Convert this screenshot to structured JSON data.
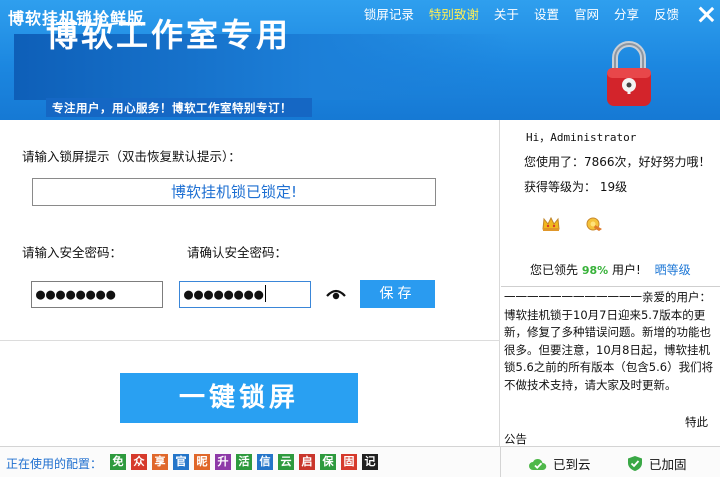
{
  "app": {
    "title": "博软挂机锁抢鲜版"
  },
  "topnav": [
    {
      "label": "锁屏记录",
      "highlight": false
    },
    {
      "label": "特别致谢",
      "highlight": true
    },
    {
      "label": "关于",
      "highlight": false
    },
    {
      "label": "设置",
      "highlight": false
    },
    {
      "label": "官网",
      "highlight": false
    },
    {
      "label": "分享",
      "highlight": false
    },
    {
      "label": "反馈",
      "highlight": false
    }
  ],
  "banner": {
    "title": "博软工作室专用",
    "slogan": "专注用户，用心服务！博软工作室特别专订！"
  },
  "form": {
    "hint_label": "请输入锁屏提示（双击恢复默认提示）：",
    "hint_value": "博软挂机锁已锁定!",
    "password_label": "请输入安全密码：",
    "confirm_label": "请确认安全密码：",
    "password_mask": "●●●●●●●●",
    "confirm_mask": "●●●●●●●●",
    "save_label": "保存",
    "lock_label": "一键锁屏"
  },
  "user": {
    "greeting": "Hi，Administrator",
    "usage": "您使用了：7866次，好好努力哦！",
    "level": "获得等级为： 19级",
    "rank_prefix": "您已领先",
    "rank_percent": "98%",
    "rank_suffix": "用户!",
    "show_level": "晒等级"
  },
  "notice": {
    "text": "一一一一一一一一一一一一亲爱的用户：博软挂机锁于10月7日迎来5.7版本的更新，修复了多种错误问题。新增的功能也很多。但要注意，10月8日起，博软挂机锁5.6之前的所有版本（包含5.6）我们将不做技术支持，请大家及时更新。",
    "special": "特此",
    "footer": "公告"
  },
  "bottom": {
    "config_label": "正在使用的配置：",
    "chips": [
      {
        "char": "免",
        "color": "#2e9a3e"
      },
      {
        "char": "众",
        "color": "#d63a2c"
      },
      {
        "char": "享",
        "color": "#e0672a"
      },
      {
        "char": "官",
        "color": "#2475c9"
      },
      {
        "char": "昵",
        "color": "#e0672a"
      },
      {
        "char": "升",
        "color": "#8e3aa8"
      },
      {
        "char": "活",
        "color": "#2e9a3e"
      },
      {
        "char": "信",
        "color": "#2475c9"
      },
      {
        "char": "云",
        "color": "#2e9a3e"
      },
      {
        "char": "启",
        "color": "#c9362c"
      },
      {
        "char": "保",
        "color": "#2e9a3e"
      },
      {
        "char": "固",
        "color": "#d63a2c"
      },
      {
        "char": "记",
        "color": "#222222"
      }
    ],
    "cloud_status": "已到云",
    "reinforced_status": "已加固"
  },
  "colors": {
    "header": "#1c87e0",
    "accent": "#29a0f2",
    "highlight": "#ffef55"
  }
}
